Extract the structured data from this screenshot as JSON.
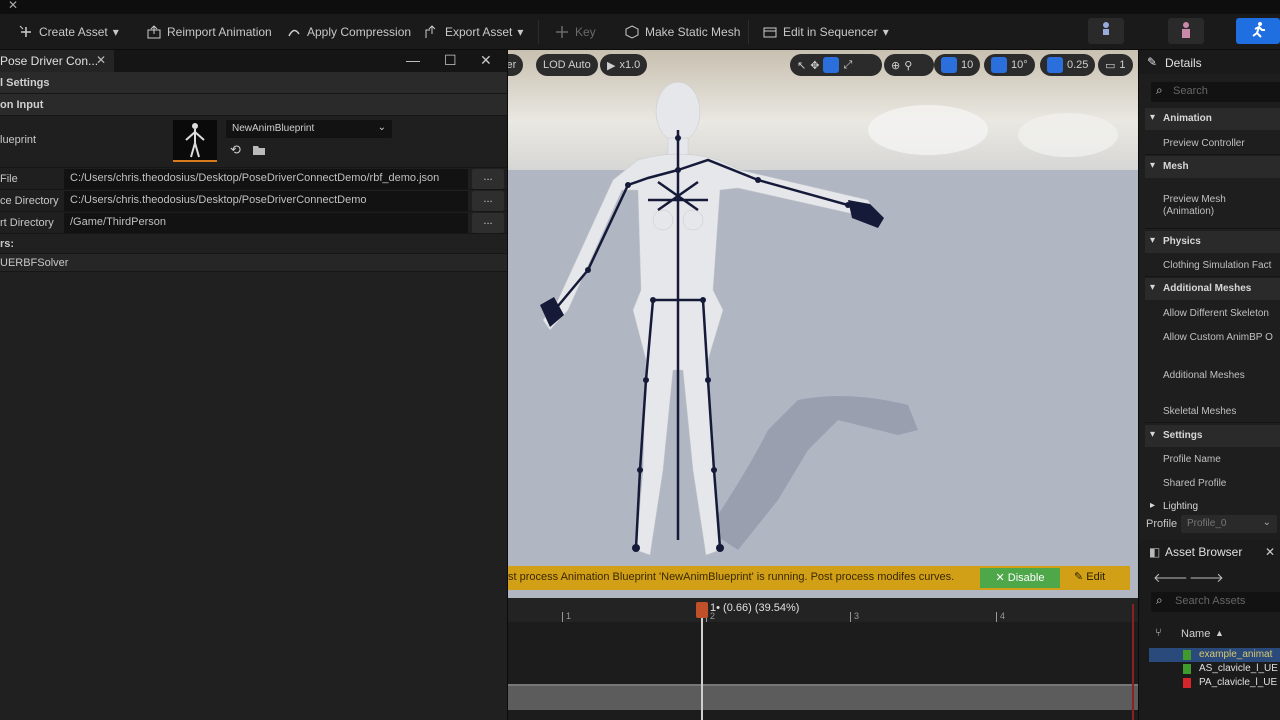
{
  "colors": {
    "accent": "#1f6fe0",
    "warning_bar": "#d2a017",
    "disable_button": "#4ea84a",
    "thumbnail_underline": "#d97a1e",
    "anim_sequence_green": "#3f9b2c",
    "pose_asset_red": "#d6262b"
  },
  "toolbar": {
    "create_asset": "Create Asset",
    "reimport_animation": "Reimport Animation",
    "apply_compression": "Apply Compression",
    "export_asset": "Export Asset",
    "key": "Key",
    "make_static_mesh": "Make Static Mesh",
    "edit_in_sequencer": "Edit in Sequencer"
  },
  "left_panel": {
    "tab_title": "Pose Driver Con...",
    "section_settings": "l Settings",
    "section_input": "on Input",
    "blueprint_label": "lueprint",
    "blueprint_value": "NewAnimBlueprint",
    "file_label": "File",
    "file_value": "C:/Users/chris.theodosius/Desktop/PoseDriverConnectDemo/rbf_demo.json",
    "source_dir_label": "ce Directory",
    "source_dir_value": "C:/Users/chris.theodosius/Desktop/PoseDriverConnectDemo",
    "import_dir_label": "rt Directory",
    "import_dir_value": "/Game/ThirdPerson",
    "solvers_label": "rs:",
    "solver_name": "UERBFSolver",
    "dots": "..."
  },
  "viewport": {
    "partial_label": "iter",
    "lod": "LOD Auto",
    "play_speed": "x1.0",
    "grid_size": "10",
    "rotation_snap": "10°",
    "scale_snap": "0.25",
    "camera_speed": "1",
    "notification": "st process Animation Blueprint 'NewAnimBlueprint' is running. Post process modifes curves.",
    "disable_label": "Disable",
    "edit_label": "Edit"
  },
  "timeline": {
    "frame_label": "1• (0.66) (39.54%)",
    "ticks": [
      "1",
      "2",
      "3",
      "4"
    ]
  },
  "details": {
    "title": "Details",
    "search_placeholder": "Search",
    "cat_animation": "Animation",
    "preview_controller": "Preview Controller",
    "cat_mesh": "Mesh",
    "preview_mesh_1": "Preview Mesh",
    "preview_mesh_2": "(Animation)",
    "cat_physics": "Physics",
    "clothing_sim": "Clothing Simulation Fact",
    "cat_additional": "Additional Meshes",
    "allow_diff_skeleton": "Allow Different Skeleton",
    "allow_custom_animbp": "Allow Custom AnimBP O",
    "additional_meshes": "Additional Meshes",
    "skeletal_meshes": "Skeletal Meshes",
    "cat_settings": "Settings",
    "profile_name": "Profile Name",
    "shared_profile": "Shared Profile",
    "cat_lighting": "Lighting",
    "profile_label": "Profile",
    "profile_value": "Profile_0"
  },
  "asset_browser": {
    "title": "Asset Browser",
    "search_placeholder": "Search Assets",
    "col_name": "Name",
    "rows": [
      "example_animat",
      "AS_clavicle_l_UE",
      "PA_clavicle_l_UE"
    ]
  }
}
